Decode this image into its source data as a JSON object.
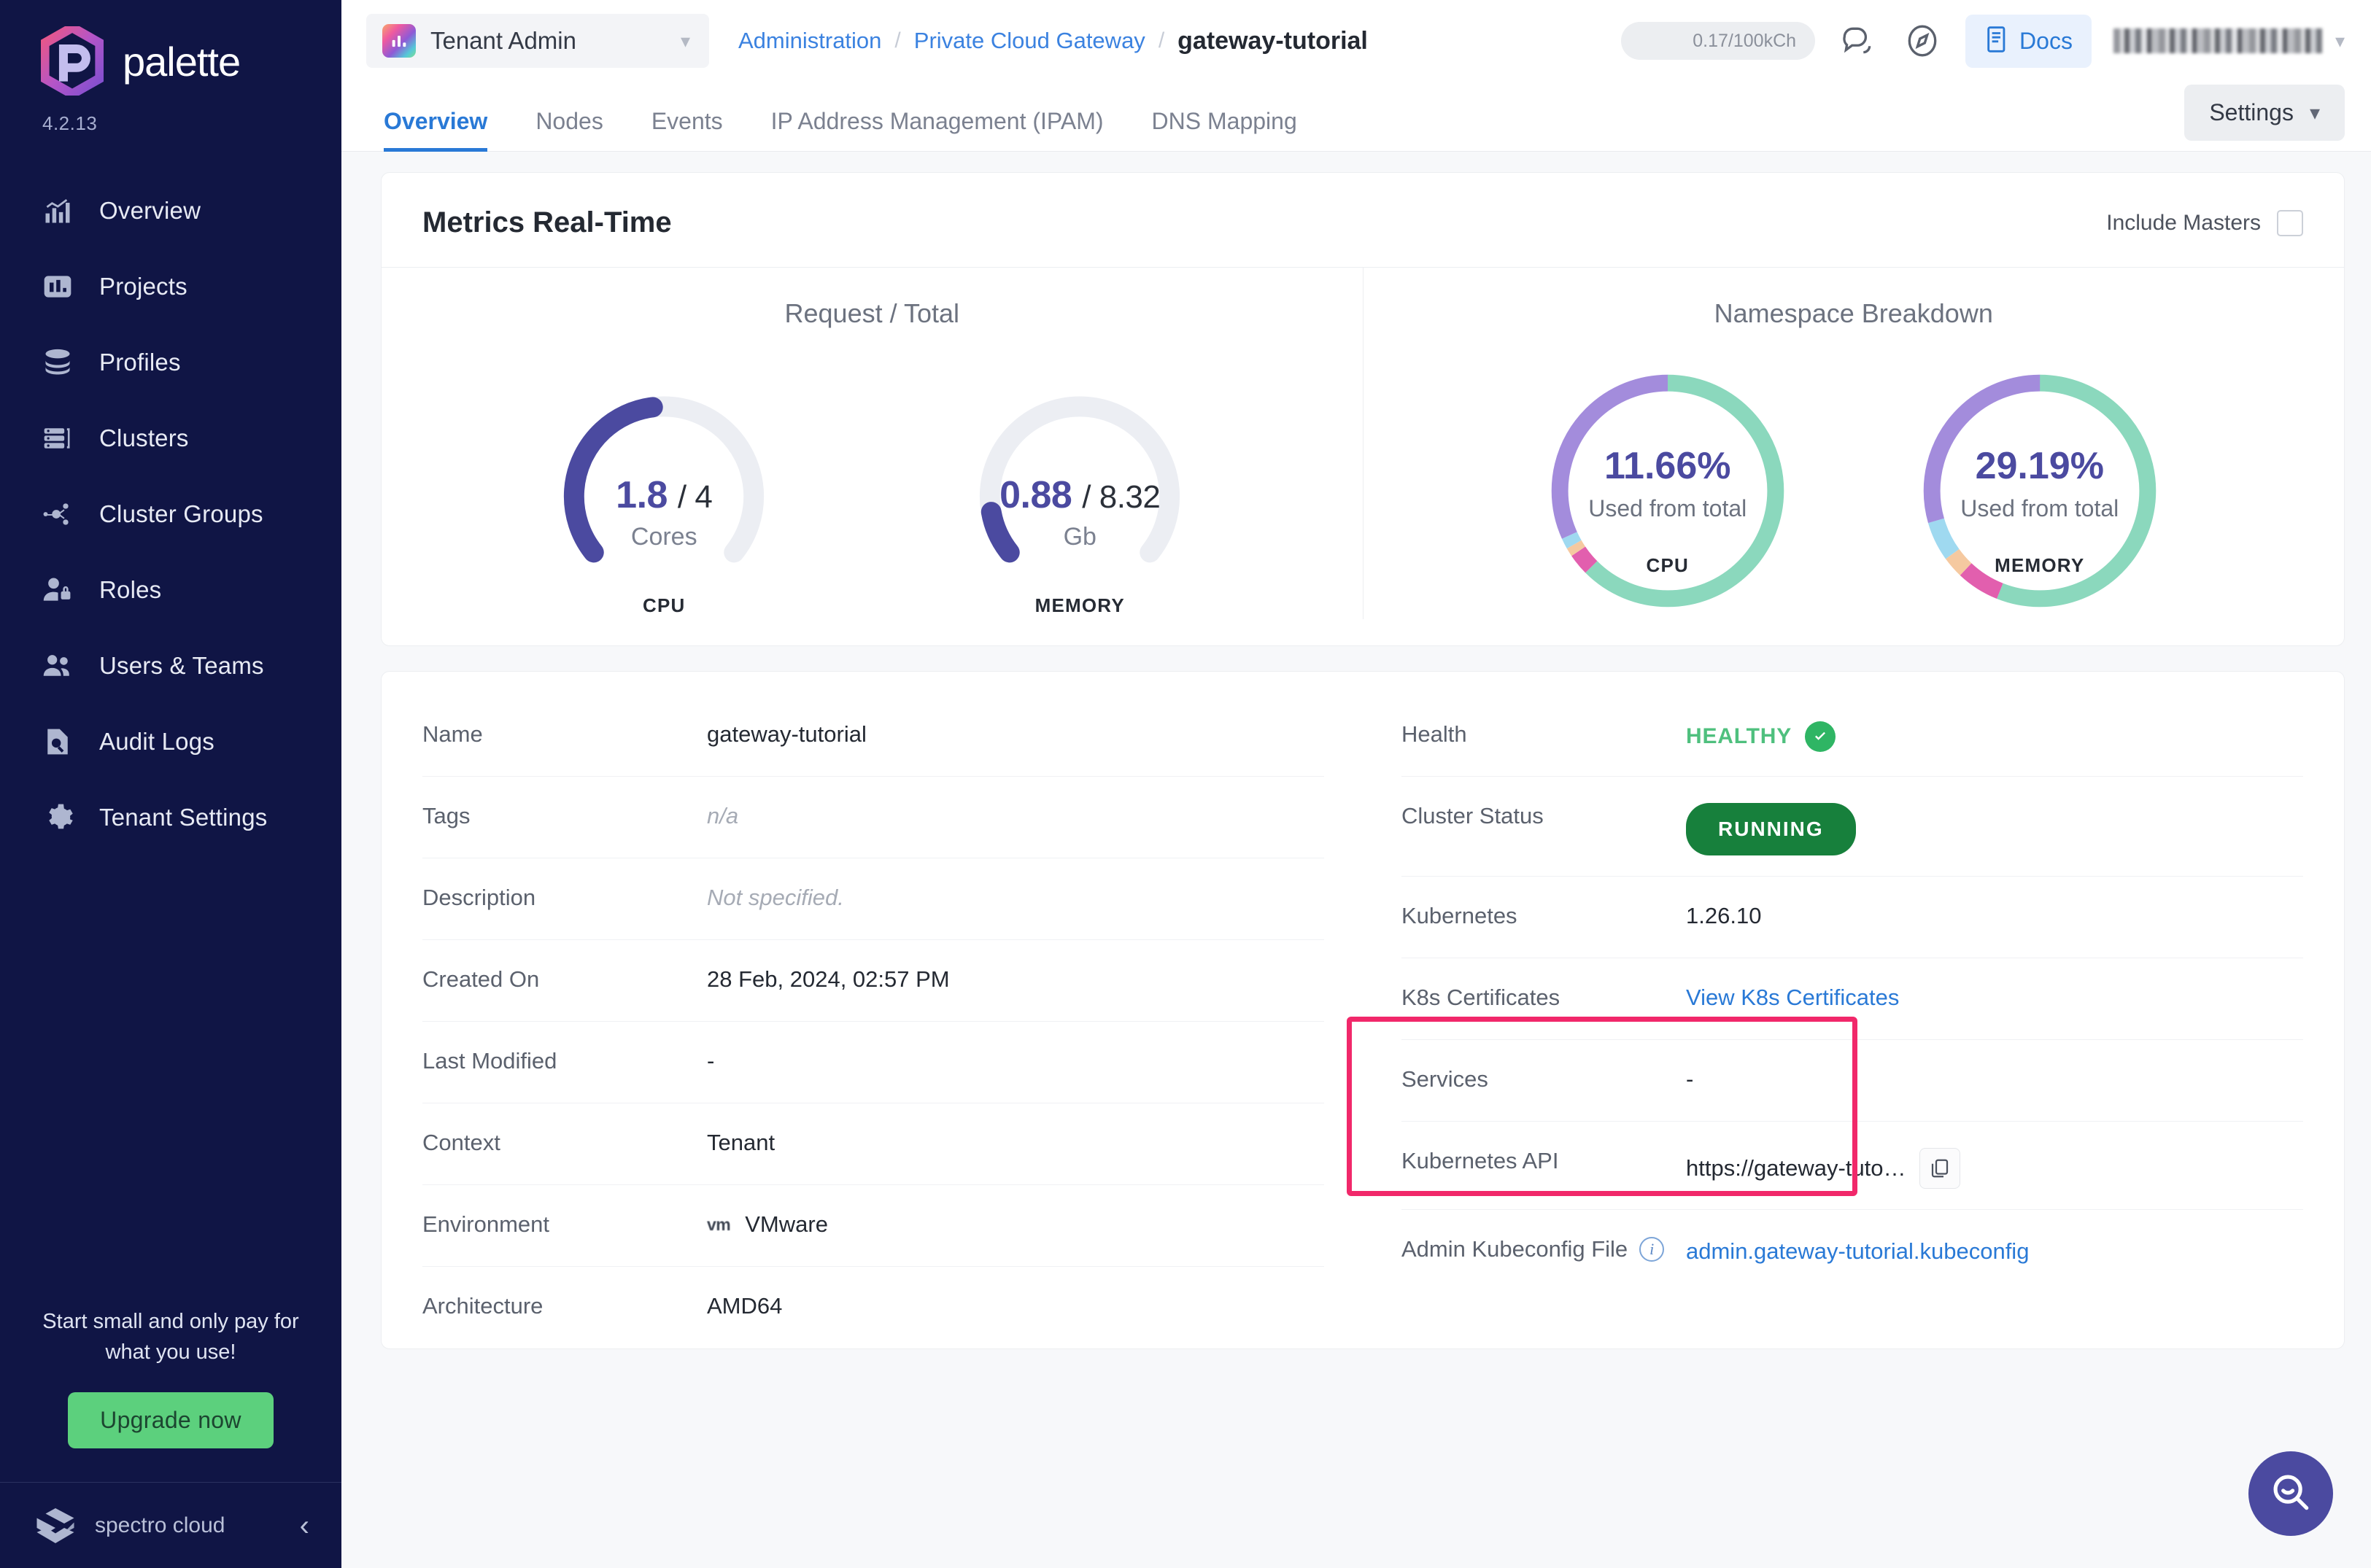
{
  "sidebar": {
    "brand_name": "palette",
    "version": "4.2.13",
    "items": [
      {
        "label": "Overview",
        "icon": "chart-bars-icon"
      },
      {
        "label": "Projects",
        "icon": "projects-icon"
      },
      {
        "label": "Profiles",
        "icon": "layers-stack-icon"
      },
      {
        "label": "Clusters",
        "icon": "server-rack-icon"
      },
      {
        "label": "Cluster Groups",
        "icon": "nodes-network-icon"
      },
      {
        "label": "Roles",
        "icon": "user-lock-icon"
      },
      {
        "label": "Users & Teams",
        "icon": "users-group-icon"
      },
      {
        "label": "Audit Logs",
        "icon": "document-search-icon"
      },
      {
        "label": "Tenant Settings",
        "icon": "gear-icon"
      }
    ],
    "promo_text": "Start small and only pay for what you use!",
    "promo_button": "Upgrade now",
    "footer_name": "spectro cloud",
    "collapse_icon": "chevron-left-icon"
  },
  "topbar": {
    "tenant_label": "Tenant Admin",
    "tenant_chevron": "chevron-down-icon",
    "breadcrumb": {
      "items": [
        "Administration",
        "Private Cloud Gateway"
      ],
      "separator": "/",
      "current": "gateway-tutorial"
    },
    "usage": "0.17/100kCh",
    "chat_icon": "chat-bubbles-icon",
    "compass_icon": "compass-icon",
    "docs_label": "Docs",
    "docs_icon": "book-icon",
    "user_chevron": "chevron-down-icon"
  },
  "tabs": [
    {
      "label": "Overview",
      "active": true
    },
    {
      "label": "Nodes",
      "active": false
    },
    {
      "label": "Events",
      "active": false
    },
    {
      "label": "IP Address Management (IPAM)",
      "active": false
    },
    {
      "label": "DNS Mapping",
      "active": false
    }
  ],
  "settings_button": {
    "label": "Settings",
    "icon": "chevron-down-icon"
  },
  "metrics": {
    "title": "Metrics Real-Time",
    "include_masters_label": "Include Masters",
    "include_masters_checked": false,
    "request_total": {
      "title": "Request / Total",
      "gauges": [
        {
          "value": "1.8",
          "divider": "/ 4",
          "unit": "Cores",
          "footer": "CPU"
        },
        {
          "value": "0.88",
          "divider": "/ 8.32",
          "unit": "Gb",
          "footer": "MEMORY"
        }
      ]
    },
    "namespace_breakdown": {
      "title": "Namespace Breakdown",
      "donuts": [
        {
          "percent": "11.66%",
          "sub": "Used from total",
          "footer": "CPU"
        },
        {
          "percent": "29.19%",
          "sub": "Used from total",
          "footer": "MEMORY"
        }
      ]
    }
  },
  "chart_data": [
    {
      "type": "gauge",
      "title": "Request / Total",
      "series": [
        {
          "name": "CPU",
          "value": 1.8,
          "total": 4,
          "unit": "Cores",
          "fraction": 0.45,
          "color": "#4b4aa0",
          "track_color": "#eceef3"
        },
        {
          "name": "MEMORY",
          "value": 0.88,
          "total": 8.32,
          "unit": "Gb",
          "fraction": 0.1058,
          "color": "#4b4aa0",
          "track_color": "#eceef3"
        }
      ],
      "arc_span_degrees": 270,
      "legend": false
    },
    {
      "type": "pie",
      "title": "Namespace Breakdown",
      "charts": [
        {
          "name": "CPU",
          "center_label": "11.66%",
          "center_sub": "Used from total",
          "values": [
            62.5,
            3.0,
            1.2,
            1.5,
            31.8
          ],
          "colors": [
            "#8bd8bd",
            "#e25fae",
            "#f5c9a0",
            "#9fd9f0",
            "#a38cdc"
          ]
        },
        {
          "name": "MEMORY",
          "center_label": "29.19%",
          "center_sub": "Used from total",
          "values": [
            56.0,
            6.0,
            3.0,
            5.5,
            29.5
          ],
          "colors": [
            "#8bd8bd",
            "#e25fae",
            "#f5c9a0",
            "#9fd9f0",
            "#a38cdc"
          ]
        }
      ],
      "legend": false
    }
  ],
  "details_left": [
    {
      "key": "Name",
      "value": "gateway-tutorial",
      "style": "normal"
    },
    {
      "key": "Tags",
      "value": "n/a",
      "style": "muted"
    },
    {
      "key": "Description",
      "value": "Not specified.",
      "style": "muted"
    },
    {
      "key": "Created On",
      "value": "28 Feb, 2024, 02:57 PM",
      "style": "normal"
    },
    {
      "key": "Last Modified",
      "value": "-",
      "style": "normal"
    },
    {
      "key": "Context",
      "value": "Tenant",
      "style": "normal"
    },
    {
      "key": "Environment",
      "value": "VMware",
      "style": "env",
      "badge": "vm"
    },
    {
      "key": "Architecture",
      "value": "AMD64",
      "style": "normal"
    }
  ],
  "details_right": {
    "health": {
      "key": "Health",
      "value": "HEALTHY",
      "icon": "check-circle-icon"
    },
    "cluster_status": {
      "key": "Cluster Status",
      "value": "RUNNING"
    },
    "rows": [
      {
        "key": "Kubernetes",
        "value": "1.26.10",
        "style": "normal"
      },
      {
        "key": "K8s Certificates",
        "value": "View K8s Certificates",
        "style": "link"
      },
      {
        "key": "Services",
        "value": "-",
        "style": "normal"
      },
      {
        "key": "Kubernetes API",
        "value": "https://gateway-tuto…",
        "style": "copy",
        "copy_icon": "copy-icon"
      },
      {
        "key": "Admin Kubeconfig File",
        "value": "admin.gateway-tutorial.kubeconfig",
        "style": "link",
        "info_icon": "info-icon"
      }
    ]
  },
  "highlight": {
    "color": "#f1286a"
  },
  "fab": {
    "icon": "search-smile-icon",
    "color": "#4b4aa0"
  },
  "colors": {
    "sidebar_bg": "#101545",
    "accent_blue": "#2979d6",
    "purple": "#4b4aa0",
    "green": "#17803c",
    "health_green": "#4fc07e",
    "upgrade_green": "#5cd07d",
    "highlight_pink": "#f1286a"
  }
}
